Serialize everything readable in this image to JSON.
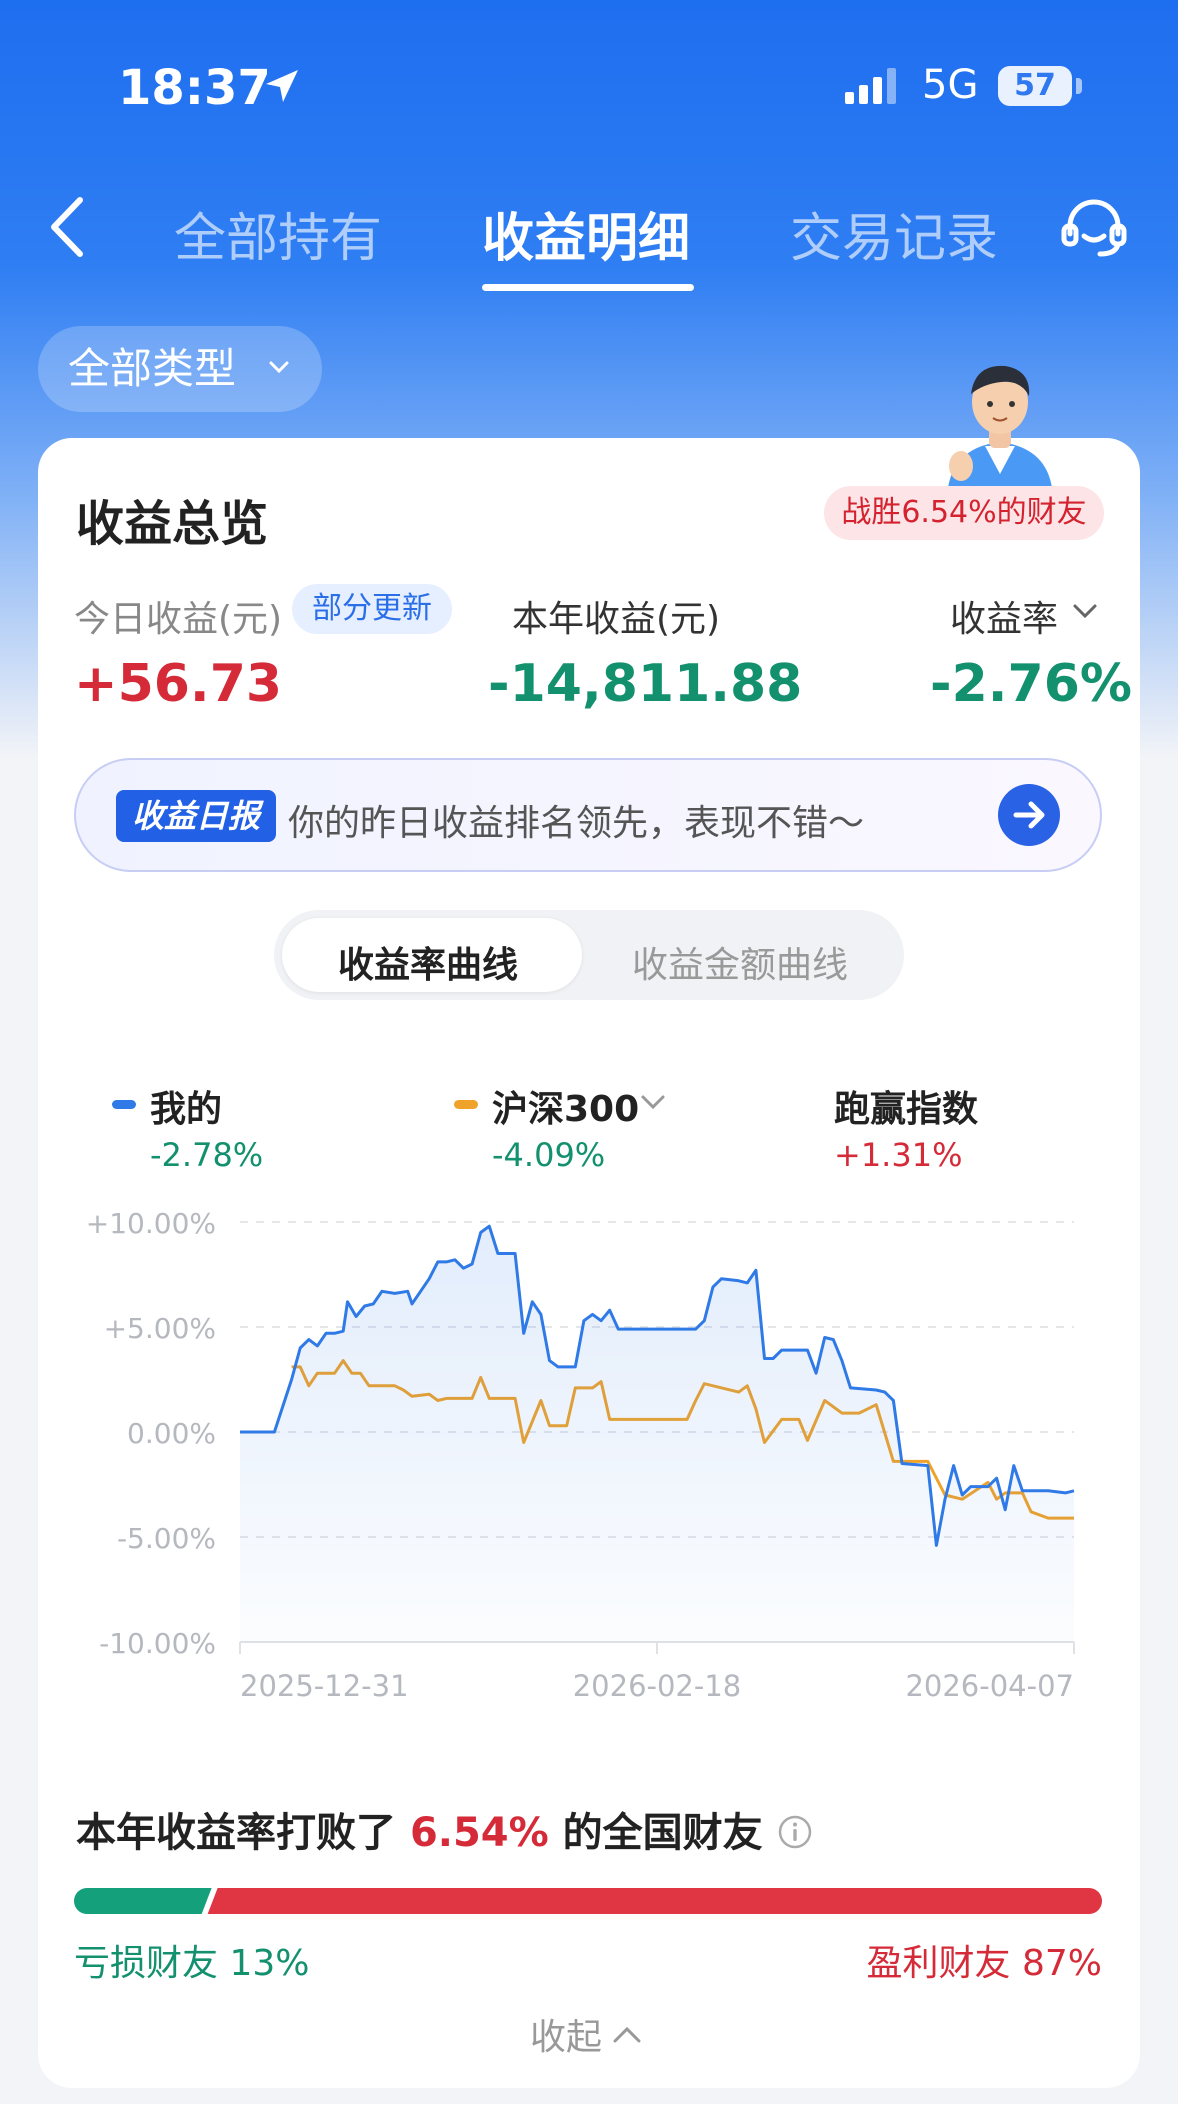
{
  "status_bar": {
    "time": "18:37",
    "network": "5G",
    "battery": "57"
  },
  "nav": {
    "tabs": [
      {
        "label": "全部持有",
        "active": false
      },
      {
        "label": "收益明细",
        "active": true
      },
      {
        "label": "交易记录",
        "active": false
      }
    ],
    "back_icon": "chevron-left-icon",
    "service_icon": "headset-icon"
  },
  "filter": {
    "label": "全部类型"
  },
  "overview": {
    "title": "收益总览",
    "beat_badge": "战胜6.54%的财友",
    "today": {
      "label": "今日收益(元)",
      "badge": "部分更新",
      "value": "+56.73"
    },
    "year": {
      "label": "本年收益(元)",
      "value": "-14,811.88"
    },
    "rate": {
      "label": "收益率",
      "value": "-2.76%"
    },
    "colors": {
      "gain": "#d52b38",
      "loss": "#13906e"
    }
  },
  "daily_report": {
    "tag": "收益日报",
    "text": "你的昨日收益排名领先，表现不错～"
  },
  "segment": {
    "options": [
      "收益率曲线",
      "收益金额曲线"
    ],
    "selected": 0
  },
  "legend": {
    "mine": {
      "name": "我的",
      "value": "-2.78%",
      "color": "#2f7ae6"
    },
    "index": {
      "name": "沪深300",
      "value": "-4.09%",
      "color": "#f0a32a"
    },
    "excess": {
      "name": "跑赢指数",
      "value": "+1.31%"
    }
  },
  "chart_data": {
    "type": "line",
    "x_ticks": [
      "2025-12-31",
      "2026-02-18",
      "2026-04-07"
    ],
    "y_ticks": [
      "+10.00%",
      "+5.00%",
      "0.00%",
      "-5.00%",
      "-10.00%"
    ],
    "ylim": [
      -10,
      10
    ],
    "grid": true,
    "x_index_range": [
      0,
      97
    ],
    "series": [
      {
        "name": "我的",
        "color": "#2f7ae6",
        "fill": true,
        "points": [
          [
            0,
            0
          ],
          [
            4,
            0
          ],
          [
            6,
            2.5
          ],
          [
            7,
            4
          ],
          [
            8,
            4.4
          ],
          [
            9,
            4.1
          ],
          [
            10,
            4.7
          ],
          [
            11,
            4.7
          ],
          [
            12,
            4.8
          ],
          [
            12.5,
            6.2
          ],
          [
            13.5,
            5.5
          ],
          [
            14.5,
            6
          ],
          [
            15.5,
            6.1
          ],
          [
            16.5,
            6.7
          ],
          [
            18,
            6.6
          ],
          [
            19.5,
            6.7
          ],
          [
            20,
            6.1
          ],
          [
            21,
            6.7
          ],
          [
            22,
            7.3
          ],
          [
            23,
            8.1
          ],
          [
            24,
            8.1
          ],
          [
            25,
            8.2
          ],
          [
            26,
            7.8
          ],
          [
            27,
            8
          ],
          [
            28,
            9.5
          ],
          [
            29,
            9.8
          ],
          [
            30,
            8.5
          ],
          [
            32,
            8.5
          ],
          [
            33,
            4.7
          ],
          [
            34,
            6.2
          ],
          [
            35,
            5.6
          ],
          [
            36,
            3.4
          ],
          [
            37,
            3.1
          ],
          [
            39,
            3.1
          ],
          [
            40,
            5.3
          ],
          [
            41,
            5.6
          ],
          [
            42,
            5.3
          ],
          [
            43,
            5.8
          ],
          [
            44,
            4.9
          ],
          [
            53,
            4.9
          ],
          [
            54,
            5.3
          ],
          [
            55,
            6.9
          ],
          [
            56,
            7.3
          ],
          [
            58,
            7.2
          ],
          [
            59,
            7.1
          ],
          [
            60,
            7.7
          ],
          [
            61,
            3.5
          ],
          [
            62,
            3.5
          ],
          [
            63,
            3.9
          ],
          [
            66,
            3.9
          ],
          [
            67,
            2.8
          ],
          [
            68,
            4.5
          ],
          [
            69,
            4.4
          ],
          [
            70,
            3.4
          ],
          [
            71,
            2.1
          ],
          [
            74,
            2
          ],
          [
            75,
            1.9
          ],
          [
            76,
            1.5
          ],
          [
            77,
            -1.5
          ],
          [
            80,
            -1.6
          ],
          [
            81,
            -5.4
          ],
          [
            82,
            -3.2
          ],
          [
            83,
            -1.6
          ],
          [
            84,
            -3
          ],
          [
            85,
            -2.6
          ],
          [
            87,
            -2.6
          ],
          [
            88,
            -2.2
          ],
          [
            89,
            -3.7
          ],
          [
            90,
            -1.6
          ],
          [
            91,
            -2.8
          ],
          [
            94,
            -2.8
          ],
          [
            96,
            -2.9
          ],
          [
            97,
            -2.8
          ]
        ]
      },
      {
        "name": "沪深300",
        "color": "#f0a32a",
        "fill": false,
        "points": [
          [
            6,
            3.1
          ],
          [
            7,
            3.1
          ],
          [
            8,
            2.2
          ],
          [
            9,
            2.8
          ],
          [
            11,
            2.8
          ],
          [
            12,
            3.4
          ],
          [
            13,
            2.8
          ],
          [
            14,
            2.8
          ],
          [
            15,
            2.2
          ],
          [
            18,
            2.2
          ],
          [
            19,
            2
          ],
          [
            20,
            1.7
          ],
          [
            22,
            1.8
          ],
          [
            23,
            1.5
          ],
          [
            24,
            1.6
          ],
          [
            27,
            1.6
          ],
          [
            28,
            2.6
          ],
          [
            29,
            1.6
          ],
          [
            32,
            1.6
          ],
          [
            33,
            -0.5
          ],
          [
            35,
            1.5
          ],
          [
            36,
            0.3
          ],
          [
            38,
            0.3
          ],
          [
            39,
            2.1
          ],
          [
            41,
            2.1
          ],
          [
            42,
            2.4
          ],
          [
            43,
            0.6
          ],
          [
            52,
            0.6
          ],
          [
            53,
            1.5
          ],
          [
            54,
            2.3
          ],
          [
            58,
            1.9
          ],
          [
            59,
            2.2
          ],
          [
            60,
            1.1
          ],
          [
            61,
            -0.5
          ],
          [
            63,
            0.6
          ],
          [
            65,
            0.6
          ],
          [
            66,
            -0.4
          ],
          [
            68,
            1.5
          ],
          [
            70,
            0.9
          ],
          [
            72,
            0.9
          ],
          [
            74,
            1.3
          ],
          [
            76,
            -1.4
          ],
          [
            80,
            -1.4
          ],
          [
            82,
            -3
          ],
          [
            84,
            -3.2
          ],
          [
            87,
            -2.4
          ],
          [
            88,
            -3.2
          ],
          [
            89,
            -2.9
          ],
          [
            91,
            -2.9
          ],
          [
            92,
            -3.8
          ],
          [
            94,
            -4.1
          ],
          [
            97,
            -4.1
          ]
        ]
      }
    ]
  },
  "beat": {
    "title_prefix": "本年收益率打败了",
    "percent": "6.54%",
    "title_suffix": "的全国财友",
    "loss_label": "亏损财友",
    "loss_pct": "13%",
    "gain_label": "盈利财友",
    "gain_pct": "87%",
    "loss_share": 0.13,
    "collapse": "收起"
  }
}
